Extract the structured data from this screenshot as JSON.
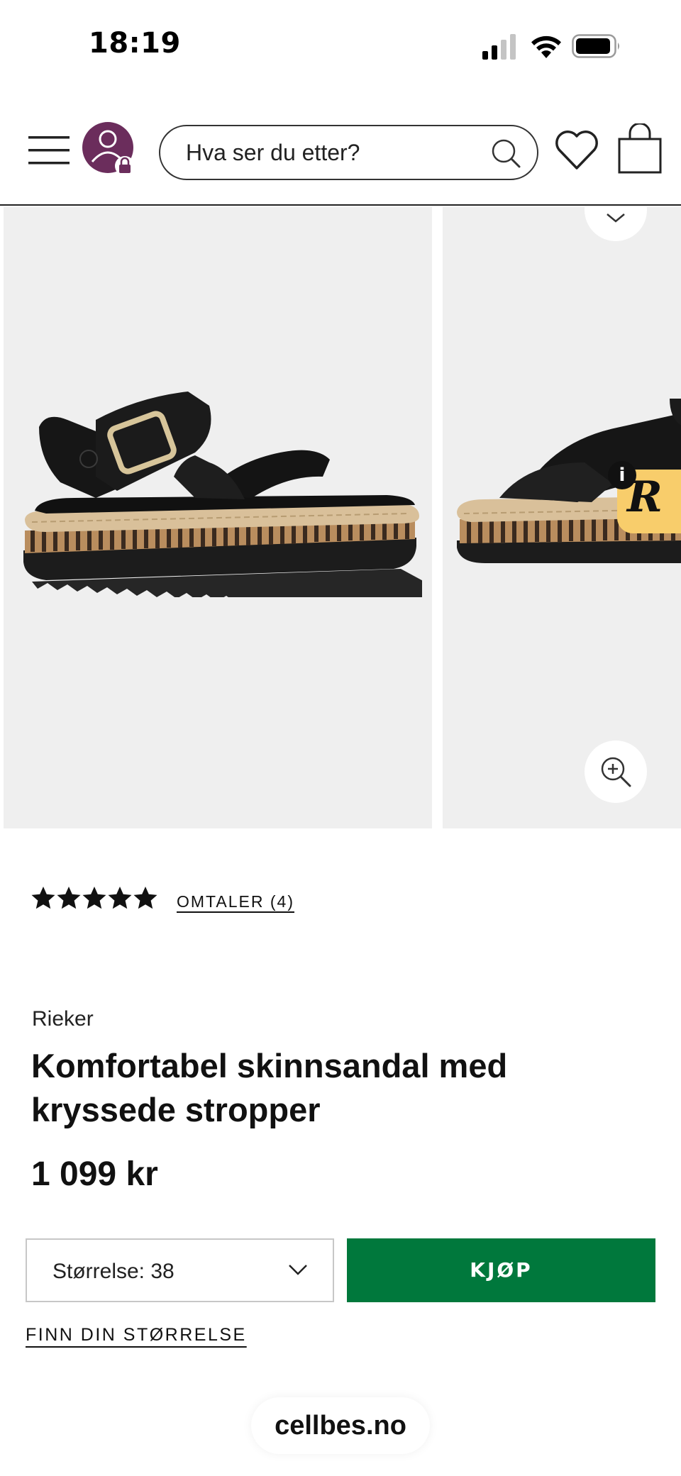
{
  "status_bar": {
    "time": "18:19",
    "icons": [
      "cellular-signal-icon",
      "wifi-icon",
      "battery-icon"
    ]
  },
  "header": {
    "icons": [
      "menu-icon",
      "user-avatar-locked-icon",
      "search-icon",
      "heart-icon",
      "shopping-bag-icon"
    ],
    "search": {
      "placeholder": "Hva ser du etter?",
      "value": ""
    },
    "avatar_color": "#6b2d5c"
  },
  "gallery": {
    "slides": [
      "product-image-side",
      "product-image-closeup"
    ],
    "icons": [
      "wishlist-chevron-icon",
      "zoom-in-icon"
    ],
    "badge": {
      "letter": "R",
      "info": "i",
      "color": "#f8cd6b"
    }
  },
  "product": {
    "rating": 5,
    "reviews_label": "OMTALER (4)",
    "brand": "Rieker",
    "title": "Komfortabel skinnsandal med kryssede stropper",
    "price": "1 099 kr"
  },
  "purchase": {
    "size_label": "Størrelse: 38",
    "buy_label": "KJØP",
    "buy_color": "#00783c",
    "size_guide_label": "FINN DIN STØRRELSE"
  },
  "browser": {
    "domain": "cellbes.no"
  }
}
